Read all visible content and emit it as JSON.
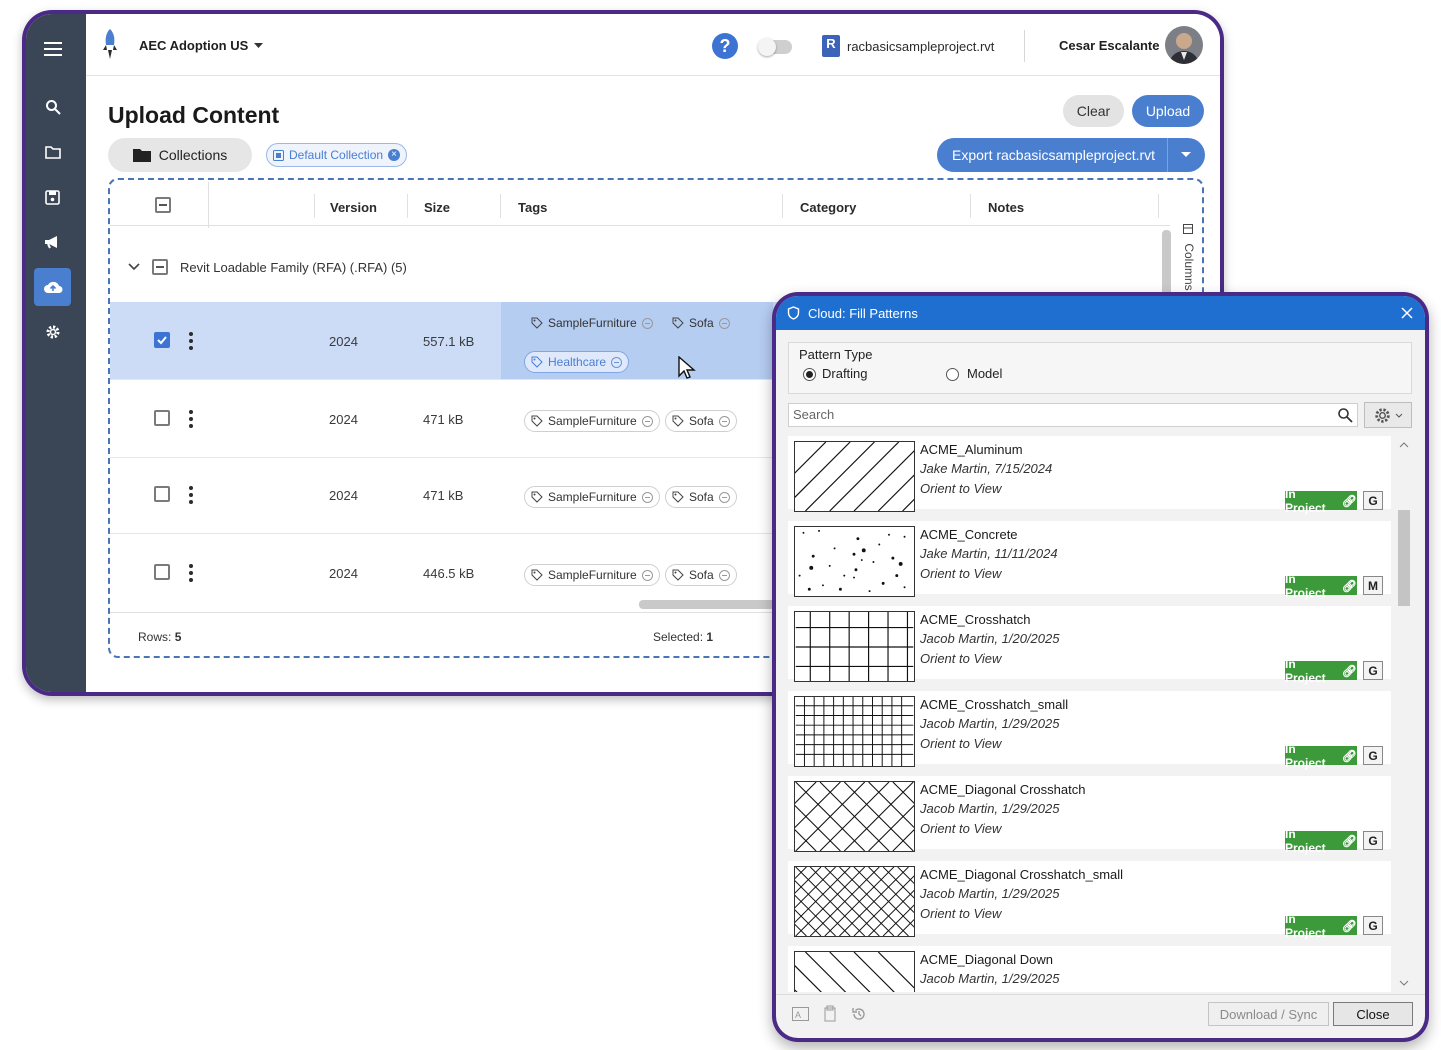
{
  "app": {
    "org_name": "AEC Adoption US",
    "project_file": "racbasicsampleproject.rvt",
    "project_file_badge": "R",
    "user_name": "Cesar Escalante",
    "page_title": "Upload Content",
    "clear_label": "Clear",
    "upload_label": "Upload",
    "collections_label": "Collections",
    "default_collection": "Default Collection",
    "export_label": "Export racbasicsampleproject.rvt",
    "columns_label": "Columns",
    "headers": {
      "version": "Version",
      "size": "Size",
      "tags": "Tags",
      "category": "Category",
      "notes": "Notes"
    },
    "group_label": "Revit Loadable Family (RFA) (.RFA) (5)",
    "rows": [
      {
        "version": "2024",
        "size": "557.1 kB",
        "tags": [
          "SampleFurniture",
          "Sofa",
          "Healthcare"
        ],
        "selected": true
      },
      {
        "version": "2024",
        "size": "471 kB",
        "tags": [
          "SampleFurniture",
          "Sofa"
        ],
        "selected": false
      },
      {
        "version": "2024",
        "size": "471 kB",
        "tags": [
          "SampleFurniture",
          "Sofa"
        ],
        "selected": false
      },
      {
        "version": "2024",
        "size": "446.5 kB",
        "tags": [
          "SampleFurniture",
          "Sofa"
        ],
        "selected": false
      }
    ],
    "footer": {
      "rows_label": "Rows:",
      "rows_value": "5",
      "selected_label": "Selected:",
      "selected_value": "1"
    },
    "sidebar_icons": [
      "menu-icon",
      "search-icon",
      "folder-icon",
      "save-icon",
      "megaphone-icon",
      "cloud-upload-icon",
      "gear-icon"
    ],
    "colors": {
      "accent": "#4a7fd0",
      "sidebar": "#3a4656",
      "frame": "#4a2a86"
    }
  },
  "dialog": {
    "title": "Cloud: Fill Patterns",
    "pattern_type_label": "Pattern Type",
    "option_drafting": "Drafting",
    "option_model": "Model",
    "selected_option": "Drafting",
    "search_placeholder": "Search",
    "in_project_label": "In Project",
    "patterns": [
      {
        "name": "ACME_Aluminum",
        "meta": "Jake Martin, 7/15/2024",
        "orient": "Orient to View",
        "badge": "G",
        "thumb": "diagonal-up"
      },
      {
        "name": "ACME_Concrete",
        "meta": "Jake Martin, 11/11/2024",
        "orient": "Orient to View",
        "badge": "M",
        "thumb": "concrete"
      },
      {
        "name": "ACME_Crosshatch",
        "meta": "Jacob Martin, 1/20/2025",
        "orient": "Orient to View",
        "badge": "G",
        "thumb": "grid"
      },
      {
        "name": "ACME_Crosshatch_small",
        "meta": "Jacob Martin, 1/29/2025",
        "orient": "Orient to View",
        "badge": "G",
        "thumb": "grid-small"
      },
      {
        "name": "ACME_Diagonal Crosshatch",
        "meta": "Jacob Martin, 1/29/2025",
        "orient": "Orient to View",
        "badge": "G",
        "thumb": "diag-cross"
      },
      {
        "name": "ACME_Diagonal Crosshatch_small",
        "meta": "Jacob Martin, 1/29/2025",
        "orient": "Orient to View",
        "badge": "G",
        "thumb": "diag-cross-small"
      },
      {
        "name": "ACME_Diagonal Down",
        "meta": "Jacob Martin, 1/29/2025",
        "orient": "",
        "badge": "",
        "thumb": "diagonal-down"
      }
    ],
    "download_label": "Download / Sync",
    "close_label": "Close",
    "colors": {
      "title_bar": "#1f6fd1",
      "in_project": "#3c9a3a"
    }
  }
}
